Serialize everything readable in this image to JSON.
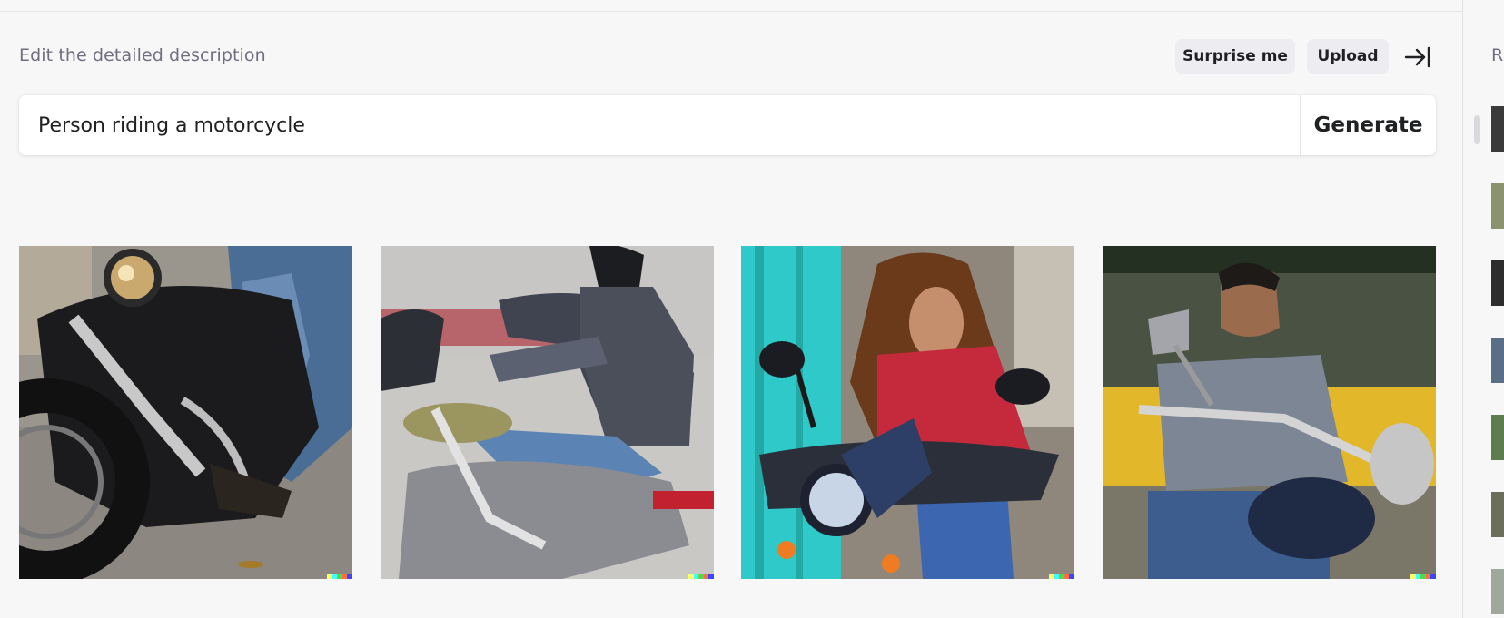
{
  "header": {
    "caption": "Edit the detailed description",
    "surprise_label": "Surprise me",
    "upload_label": "Upload",
    "collapse_icon": "collapse-right-icon"
  },
  "prompt": {
    "value": "Person riding a motorcycle",
    "generate_label": "Generate"
  },
  "results": [
    {
      "subject": "motorcycle-closeup-image"
    },
    {
      "subject": "rider-in-leather-jacket-image"
    },
    {
      "subject": "woman-on-motorcycle-image"
    },
    {
      "subject": "man-on-motorcycle-image"
    }
  ],
  "signature_colors": [
    "#ffff66",
    "#42ffff",
    "#51da4c",
    "#ff6e3c",
    "#3c46ff"
  ],
  "sidebar": {
    "label": "R",
    "thumbnail_count": 7
  },
  "colors": {
    "background": "#f7f7f8",
    "pill_button": "#ececf1",
    "caption_text": "#6e6e80"
  }
}
